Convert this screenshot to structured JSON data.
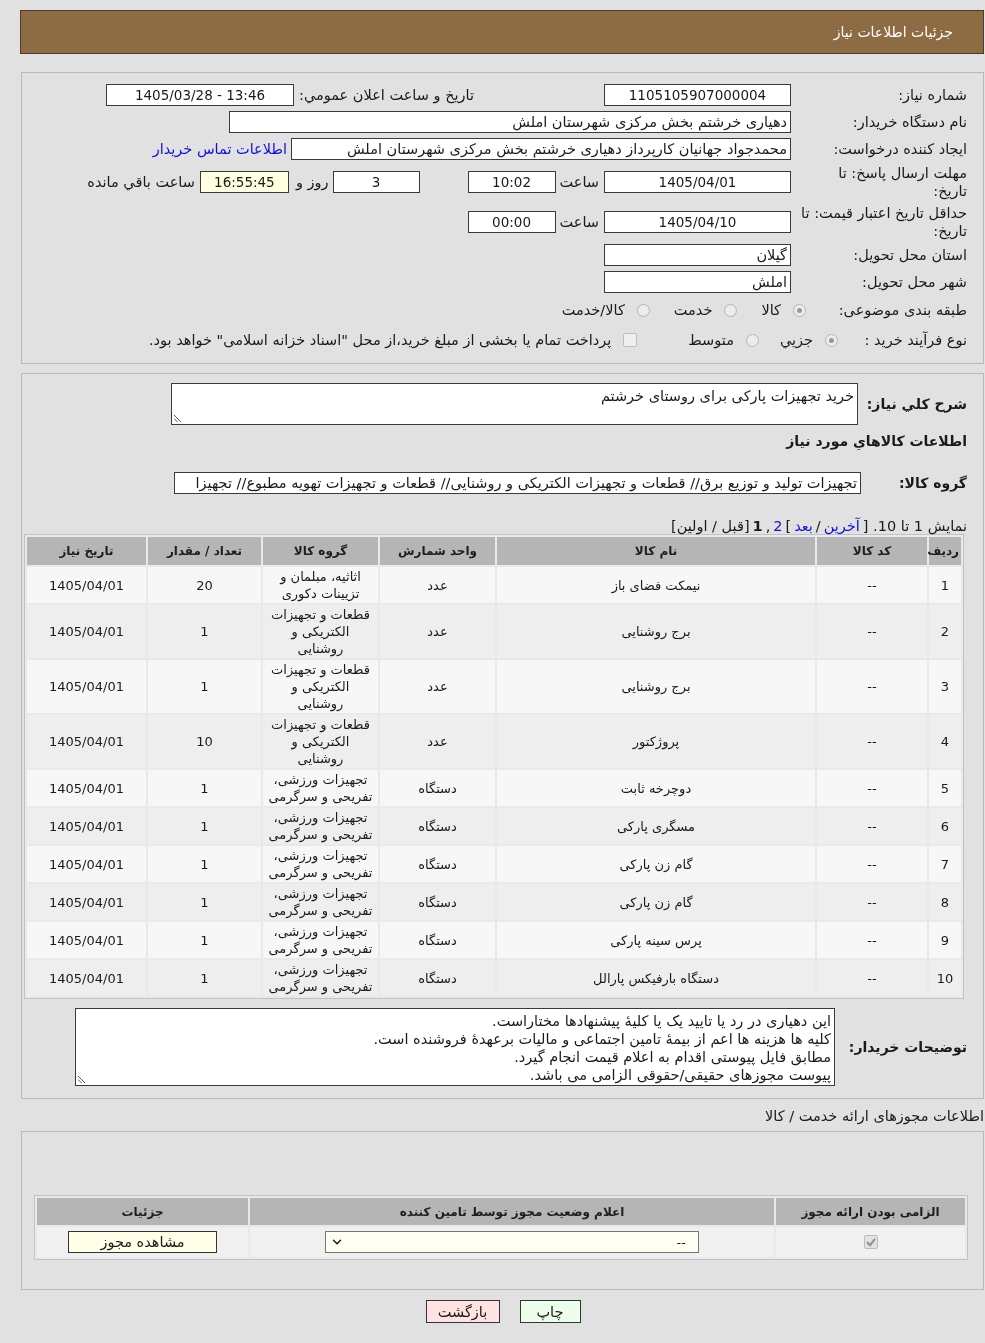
{
  "header": {
    "title": "جزئیات اطلاعات نیاز"
  },
  "details": {
    "need_number": {
      "label": "شماره نیاز:",
      "value": "1105105907000004"
    },
    "announce_datetime": {
      "label": "تاریخ و ساعت اعلان عمومي:",
      "value": "1405/03/28 - 13:46"
    },
    "buyer_org": {
      "label": "نام دستگاه خریدار:",
      "value": "دهیاری خرشتم بخش مرکزی شهرستان املش"
    },
    "requester": {
      "label": "ایجاد کننده درخواست:",
      "value": "محمدجواد جهانیان کارپرداز دهیاری خرشتم بخش مرکزی شهرستان املش",
      "contact_link": "اطلاعات تماس خریدار"
    },
    "response_deadline": {
      "label": "مهلت ارسال پاسخ: تا تاریخ:",
      "date": "1405/04/01",
      "time_label": "ساعت",
      "time": "10:02",
      "days": "3",
      "days_label": "روز و",
      "remaining": "16:55:45",
      "remaining_label": "ساعت باقي مانده"
    },
    "price_validity": {
      "label": "حداقل تاریخ اعتبار قیمت: تا تاریخ:",
      "date": "1405/04/10",
      "time_label": "ساعت",
      "time": "00:00"
    },
    "delivery_province": {
      "label": "استان محل تحویل:",
      "value": "گیلان"
    },
    "delivery_city": {
      "label": "شهر محل تحویل:",
      "value": "املش"
    },
    "category": {
      "label": "طبقه بندی موضوعی:",
      "options": [
        {
          "label": "کالا",
          "selected": true
        },
        {
          "label": "خدمت",
          "selected": false
        },
        {
          "label": "کالا/خدمت",
          "selected": false
        }
      ]
    },
    "purchase_process": {
      "label": "نوع فرآیند خرید :",
      "options": [
        {
          "label": "جزيي",
          "selected": true
        },
        {
          "label": "متوسط",
          "selected": false
        }
      ],
      "treasury_checkbox": {
        "label": "پرداخت تمام یا بخشی از مبلغ خرید،از محل \"اسناد خزانه اسلامی\" خواهد بود.",
        "checked": false
      }
    }
  },
  "need": {
    "summary_label": "شرح کلي نیاز:",
    "summary": "خرید تجهیزات پارکی برای روستای خرشتم",
    "goods_heading": "اطلاعات کالاهاي مورد نیاز",
    "group_label": "گروه کالا:",
    "group_value": "تجهیزات تولید و توزیع برق// قطعات و تجهیزات الکتریکی و روشنایی//  قطعات و تجهیزات تهویه مطبوع// تجهیزا",
    "pagination": [
      {
        "kind": "text",
        "text": "نمایش 1 تا 10. ["
      },
      {
        "kind": "link",
        "text": "آخرین"
      },
      {
        "kind": "text",
        "text": "/"
      },
      {
        "kind": "link",
        "text": "بعد"
      },
      {
        "kind": "text",
        "text": "]"
      },
      {
        "kind": "link",
        "text": "2"
      },
      {
        "kind": "text",
        "text": ","
      },
      {
        "kind": "current",
        "text": "1"
      },
      {
        "kind": "text",
        "text": "[قبل / اولین]"
      }
    ],
    "table": {
      "columns": [
        "ردیف",
        "کد کالا",
        "نام کالا",
        "واحد شمارش",
        "گروه کالا",
        "تعداد / مقدار",
        "تاریخ نیاز"
      ],
      "rows": [
        [
          "1",
          "--",
          "نیمکت فضای باز",
          "عدد",
          "اثاثیه، مبلمان و تزیینات دکوری",
          "20",
          "1405/04/01"
        ],
        [
          "2",
          "--",
          "برج روشنایی",
          "عدد",
          "قطعات و تجهیزات الکتریکی و روشنایی",
          "1",
          "1405/04/01"
        ],
        [
          "3",
          "--",
          "برج روشنایی",
          "عدد",
          "قطعات و تجهیزات الکتریکی و روشنایی",
          "1",
          "1405/04/01"
        ],
        [
          "4",
          "--",
          "پروژکتور",
          "عدد",
          "قطعات و تجهیزات الکتریکی و روشنایی",
          "10",
          "1405/04/01"
        ],
        [
          "5",
          "--",
          "دوچرخه ثابت",
          "دستگاه",
          "تجهیزات ورزشی، تفریحی و سرگرمی",
          "1",
          "1405/04/01"
        ],
        [
          "6",
          "--",
          "مسگری پارکی",
          "دستگاه",
          "تجهیزات ورزشی، تفریحی و سرگرمی",
          "1",
          "1405/04/01"
        ],
        [
          "7",
          "--",
          "گام زن پارکی",
          "دستگاه",
          "تجهیزات ورزشی، تفریحی و سرگرمی",
          "1",
          "1405/04/01"
        ],
        [
          "8",
          "--",
          "گام زن پارکی",
          "دستگاه",
          "تجهیزات ورزشی، تفریحی و سرگرمی",
          "1",
          "1405/04/01"
        ],
        [
          "9",
          "--",
          "پرس سینه پارکی",
          "دستگاه",
          "تجهیزات ورزشی، تفریحی و سرگرمی",
          "1",
          "1405/04/01"
        ],
        [
          "10",
          "--",
          "دستگاه بارفیکس پارالل",
          "دستگاه",
          "تجهیزات ورزشی، تفریحی و سرگرمی",
          "1",
          "1405/04/01"
        ]
      ]
    },
    "notes_label": "توضیحات خریدار:",
    "notes": "این دهیاری در رد یا تایید یک یا کلیهٔ پیشنهادها مختاراست.\nکلیه ها هزینه ها اعم از بیمهٔ تامین اجتماعی و مالیات برعهدهٔ فروشنده است.\nمطابق فایل پیوستی اقدام به اعلام قیمت انجام گیرد.\nپیوست مجوزهای حقیقی/حقوقی الزامی می باشد."
  },
  "licenses": {
    "heading": "اطلاعات مجوزهای ارائه خدمت / کالا",
    "columns": [
      "الزامی بودن ارائه مجوز",
      "اعلام وضعیت مجوز توسط تامین کننده",
      "جزئیات"
    ],
    "rows": [
      {
        "checked": true,
        "status": "--",
        "action": "مشاهده مجوز"
      }
    ]
  },
  "buttons": [
    {
      "label": "چاپ",
      "kind": "print"
    },
    {
      "label": "بازگشت",
      "kind": "back"
    }
  ]
}
